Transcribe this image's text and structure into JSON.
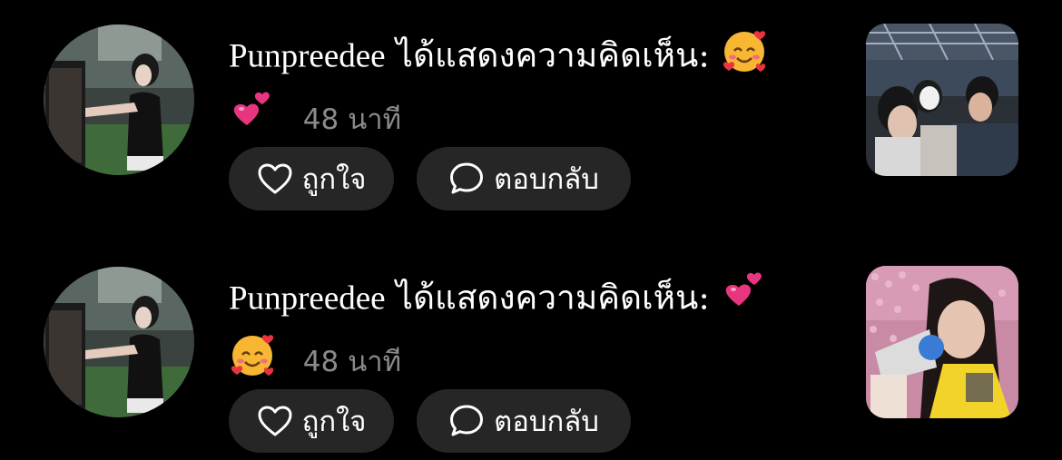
{
  "notifications": [
    {
      "username": "Punpreedee",
      "action": "ได้แสดงความคิดเห็น:",
      "emoji_first": "smiling-face-with-hearts",
      "emoji_second": "two-hearts",
      "time": "48 นาที",
      "like_label": "ถูกใจ",
      "reply_label": "ตอบกลับ"
    },
    {
      "username": "Punpreedee",
      "action": "ได้แสดงความคิดเห็น:",
      "emoji_first": "two-hearts",
      "emoji_second": "smiling-face-with-hearts",
      "time": "48 นาที",
      "like_label": "ถูกใจ",
      "reply_label": "ตอบกลับ"
    }
  ],
  "colors": {
    "background": "#000000",
    "button_bg": "#262626",
    "muted_text": "#8a8a8a",
    "heart_pink": "#e8357f"
  }
}
